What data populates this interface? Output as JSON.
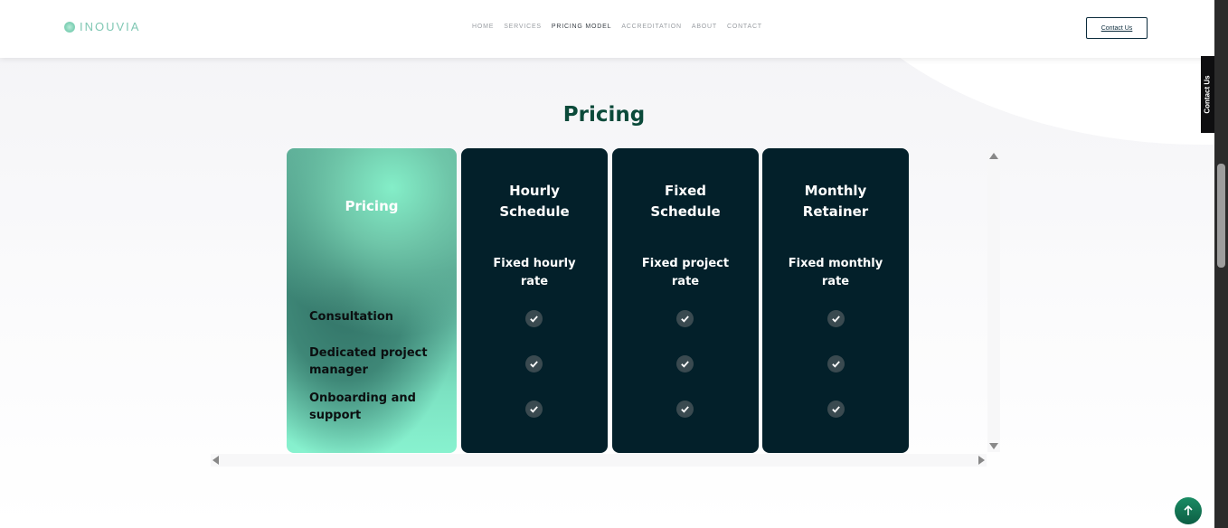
{
  "header": {
    "logo_text": "INOUVIA",
    "nav": [
      {
        "label": "HOME",
        "active": false
      },
      {
        "label": "SERVICES",
        "active": false
      },
      {
        "label": "PRICING MODEL",
        "active": true
      },
      {
        "label": "ACCREDITATION",
        "active": false
      },
      {
        "label": "ABOUT",
        "active": false
      },
      {
        "label": "CONTACT",
        "active": false
      }
    ],
    "contact_button": "Contact Us"
  },
  "side_tab": "Contact Us",
  "section_title": "Pricing",
  "table": {
    "label_column_header": "Pricing",
    "rows": [
      "Consultation",
      "Dedicated project manager",
      "Onboarding and support"
    ],
    "plans": [
      {
        "name_line1": "Hourly",
        "name_line2": "Schedule",
        "rate_line1": "Fixed hourly",
        "rate_line2": "rate",
        "features": [
          true,
          true,
          true
        ]
      },
      {
        "name_line1": "Fixed",
        "name_line2": "Schedule",
        "rate_line1": "Fixed project",
        "rate_line2": "rate",
        "features": [
          true,
          true,
          true
        ]
      },
      {
        "name_line1": "Monthly",
        "name_line2": "Retainer",
        "rate_line1": "Fixed monthly",
        "rate_line2": "rate",
        "features": [
          true,
          true,
          true
        ]
      }
    ]
  },
  "colors": {
    "plan_bg": "#03202a",
    "title": "#0b4a3a",
    "accent": "#84eec8"
  }
}
